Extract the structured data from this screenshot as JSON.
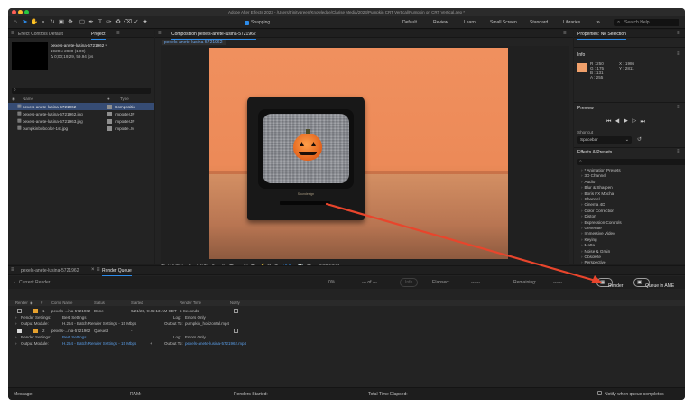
{
  "window": {
    "title": "Adobe After Effects 2023 - /Users/trinitygreen/Knowledge/Clarise Media/2023/Pumpkin CRT Vertical/Pumpkin on CRT Vertical.aep *"
  },
  "toolbar": {
    "snapping_label": "Snapping",
    "workspaces": [
      "Default",
      "Review",
      "Learn",
      "Small Screen",
      "Standard",
      "Libraries"
    ],
    "search_placeholder": "Search Help"
  },
  "project_panel": {
    "tabs": [
      "Effect Controls Default",
      "Project"
    ],
    "active_tab": "Project",
    "selected_asset": {
      "name": "pexels-anete-lusina-5721962 ▾",
      "line1": "1920 x 2880 (1.00)",
      "line2": "Δ 0;00;19;29, 59.94 fps"
    },
    "columns": {
      "name": "Name",
      "type": "Type"
    },
    "items": [
      {
        "name": "pexels-anete-lusina-5721962",
        "type": "Compositio",
        "selected": true,
        "icon": "composition-icon"
      },
      {
        "name": "pexels-anete-lusina-5721962.jpg",
        "type": "ImporterJP",
        "selected": false,
        "icon": "image-file-icon"
      },
      {
        "name": "pexels-anete-lusina-5721963.jpg",
        "type": "ImporterJP",
        "selected": false,
        "icon": "image-file-icon"
      },
      {
        "name": "pumpkinbobcolor-1st.jpg",
        "type": "Importe..M",
        "selected": false,
        "icon": "video-file-icon"
      }
    ],
    "bpc_label": "8 bpc"
  },
  "composition": {
    "tab_label": "Composition pexels-anete-lusina-5721962",
    "sub_tab": "pexels-anete-lusina-5721962",
    "tv_brand": "Soundesign",
    "zoom": "(44.7%)",
    "resolution": "(Half)",
    "exposure": "+0.0",
    "timecode": "0;00;13;21"
  },
  "right_column": {
    "properties_title": "Properties: No Selection",
    "info_title": "Info",
    "info_values": {
      "r": "R : 250",
      "g": "G : 175",
      "b": "B : 131",
      "a": "A : 255",
      "x": "X : 1986",
      "y": "Y : 2811"
    },
    "preview_title": "Preview",
    "shortcut_label": "Shortcut",
    "shortcut_value": "Spacebar",
    "effects_title": "Effects & Presets",
    "effects_items": [
      "* Animation Presets",
      "3D Channel",
      "Audio",
      "Blur & Sharpen",
      "Boris FX Mocha",
      "Channel",
      "Cinema 4D",
      "Color Correction",
      "Distort",
      "Expression Controls",
      "Generate",
      "Immersive Video",
      "Keying",
      "Matte",
      "Noise & Grain",
      "Obsolete",
      "Perspective"
    ]
  },
  "render_queue": {
    "tabs": [
      "pexels-anete-lusina-5721962",
      "Render Queue"
    ],
    "active_tab": "Render Queue",
    "current_render_label": "Current Render",
    "elapsed_label": "Elapsed:",
    "elapsed_value": "------",
    "remaining_label": "Remaining:",
    "remaining_value": "------",
    "progress_text": "--- of ---",
    "info_button": "Info",
    "render_button": "Render",
    "queue_ame_button": "Queue in AME",
    "pct_label": "0%",
    "columns": [
      "Render",
      "#",
      "Comp Name",
      "Status",
      "Started",
      "Render Time",
      "Notify"
    ],
    "items": [
      {
        "number": "1",
        "comp_name": "pexels-...ina-5721962",
        "status": "Done",
        "started": "9/21/23, 9:46:13 AM CDT",
        "render_time": "5 Seconds",
        "render_settings": "Best Settings",
        "output_module": "H.264 - Batch Render Settings - 15 Mbps",
        "log": "Errors Only",
        "output_to": "pumpkin_horizontal.mp4",
        "checked": false
      },
      {
        "number": "2",
        "comp_name": "pexels-...ina-5721962",
        "status": "Queued",
        "started": "-",
        "render_time": "",
        "render_settings": "Best Settings",
        "output_module": "H.264 - Batch Render Settings - 15 Mbps",
        "log": "Errors Only",
        "output_to": "pexels-anete-lusina-5721962.mp4",
        "checked": true
      }
    ],
    "labels": {
      "render_settings": "Render Settings:",
      "output_module": "Output Module:",
      "log": "Log:",
      "output_to": "Output To:"
    }
  },
  "footer": {
    "message": "Message:",
    "ram": "RAM:",
    "renders_started": "Renders Started:",
    "total_time": "Total Time Elapsed:",
    "notify": "Notify when queue completes"
  },
  "colors": {
    "accent": "#2d8ceb",
    "selected_row": "#364c74",
    "annotation_arrow": "#e8452c",
    "label_swatch": "#e6a12e",
    "info_swatch": "#f0a06b"
  }
}
